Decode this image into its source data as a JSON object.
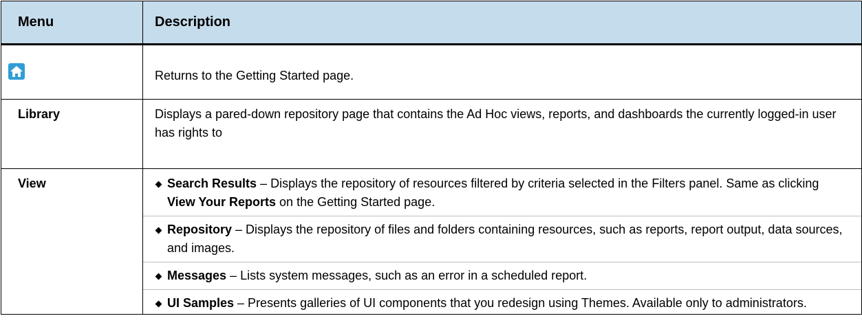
{
  "table": {
    "headers": {
      "menu": "Menu",
      "description": "Description"
    },
    "rows": [
      {
        "menu_icon": "home-icon",
        "description": "Returns to the Getting Started page."
      },
      {
        "menu": "Library",
        "description": "Displays a pared-down repository page that contains the Ad Hoc views, reports, and dashboards the currently logged-in user has rights to"
      },
      {
        "menu": "View",
        "items": [
          {
            "term": "Search Results",
            "text_before": " – Displays the repository of resources filtered by criteria selected in the Filters panel. Same as clicking ",
            "emphasis": "View Your Reports",
            "text_after": " on the Getting Started page."
          },
          {
            "term": "Repository",
            "text": " – Displays the repository of files and folders containing resources, such as reports, report output, data sources, and images."
          },
          {
            "term": "Messages",
            "text": " – Lists system messages, such as an error in a scheduled report."
          },
          {
            "term": "UI Samples",
            "text": " – Presents galleries of UI components that you redesign using Themes. Available only to administrators."
          }
        ]
      }
    ]
  },
  "colors": {
    "header_background": "#c5dcec",
    "icon_background": "#2f9ed6",
    "border": "#000000",
    "divider": "#bfbfbf"
  }
}
